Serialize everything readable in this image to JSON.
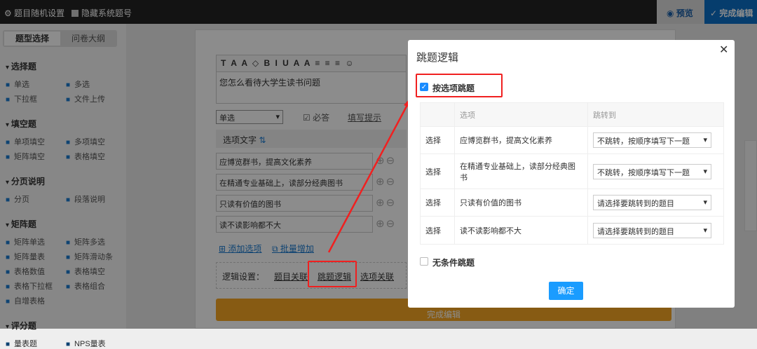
{
  "topbar": {
    "random_settings": "题目随机设置",
    "hide_numbers": "隐藏系统题号",
    "preview": "预览",
    "finish_edit": "完成编辑"
  },
  "sidebar": {
    "tabs": [
      "题型选择",
      "问卷大纲"
    ],
    "groups": [
      {
        "title": "选择题",
        "items": [
          {
            "icon": "dot-icon",
            "label": "单选"
          },
          {
            "icon": "check-icon",
            "label": "多选"
          },
          {
            "icon": "dropdown-icon",
            "label": "下拉框"
          },
          {
            "icon": "cloud-upload-icon",
            "label": "文件上传"
          }
        ]
      },
      {
        "title": "填空题",
        "items": [
          {
            "icon": "text-cursor-icon",
            "label": "单项填空"
          },
          {
            "icon": "braces-icon",
            "label": "多项填空"
          },
          {
            "icon": "matrix-icon",
            "label": "矩阵填空"
          },
          {
            "icon": "table-icon",
            "label": "表格填空"
          }
        ]
      },
      {
        "title": "分页说明",
        "items": [
          {
            "icon": "page-break-icon",
            "label": "分页"
          },
          {
            "icon": "text-icon",
            "label": "段落说明"
          }
        ]
      },
      {
        "title": "矩阵题",
        "items": [
          {
            "icon": "circles-icon",
            "label": "矩阵单选"
          },
          {
            "icon": "check-icon",
            "label": "矩阵多选"
          },
          {
            "icon": "stars-icon",
            "label": "矩阵量表"
          },
          {
            "icon": "slider-icon",
            "label": "矩阵滑动条"
          },
          {
            "icon": "number-icon",
            "label": "表格数值"
          },
          {
            "icon": "table-icon",
            "label": "表格填空"
          },
          {
            "icon": "select-box-icon",
            "label": "表格下拉框"
          },
          {
            "icon": "combo-icon",
            "label": "表格组合"
          },
          {
            "icon": "plus-icon",
            "label": "自增表格"
          }
        ]
      },
      {
        "title": "评分题",
        "items": [
          {
            "icon": "star-icon",
            "label": "量表题"
          },
          {
            "icon": "nps-icon",
            "label": "NPS量表"
          }
        ]
      }
    ]
  },
  "editor": {
    "toolbar": "T A A ◇ B I U A A ≡ ≡ ≡ ☺",
    "question": "您怎么看待大学生读书问题",
    "type": "单选",
    "required": "必答",
    "hint": "填写提示",
    "options_header": "选项文字",
    "options": [
      "应博览群书，提高文化素养",
      "在精通专业基础上，读部分经典图书",
      "只读有价值的图书",
      "读不读影响都不大"
    ],
    "add_option": "添加选项",
    "bulk_add": "批量增加",
    "logic_label": "逻辑设置：",
    "logic_links": [
      "题目关联",
      "跳题逻辑",
      "选项关联"
    ],
    "finish": "完成编辑"
  },
  "modal": {
    "title": "跳题逻辑",
    "by_option": {
      "label": "按选项跳题",
      "checked": true
    },
    "columns": [
      "",
      "选项",
      "跳转到"
    ],
    "rows": [
      {
        "action": "选择",
        "option": "应博览群书，提高文化素养",
        "jump": "不跳转，按顺序填写下一题"
      },
      {
        "action": "选择",
        "option": "在精通专业基础上，读部分经典图书",
        "jump": "不跳转，按顺序填写下一题"
      },
      {
        "action": "选择",
        "option": "只读有价值的图书",
        "jump": "请选择要跳转到的题目"
      },
      {
        "action": "选择",
        "option": "读不读影响都不大",
        "jump": "请选择要跳转到的题目"
      }
    ],
    "unconditional": {
      "label": "无条件跳题",
      "checked": false
    },
    "confirm": "确定"
  },
  "colors": {
    "accent": "#1a9cff",
    "annotation": "#f02020",
    "finish_bar": "#f5a623"
  }
}
